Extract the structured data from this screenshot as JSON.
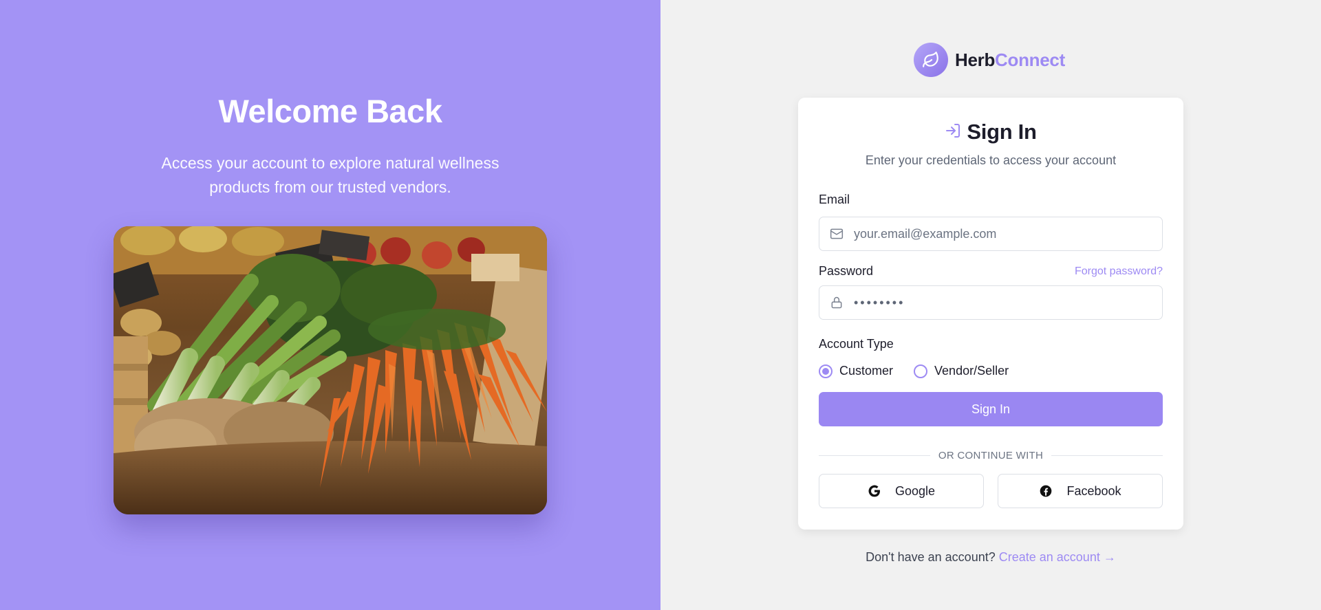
{
  "hero": {
    "title": "Welcome Back",
    "subtitle": "Access your account to explore natural wellness products from our trusted vendors."
  },
  "brand": {
    "name_part1": "Herb",
    "name_part2": "Connect",
    "logo_icon": "leaf-icon",
    "accent_color": "#9d8af3"
  },
  "signin": {
    "title": "Sign In",
    "title_icon": "login-icon",
    "subtitle": "Enter your credentials to access your account",
    "email_label": "Email",
    "email_placeholder": "your.email@example.com",
    "email_icon": "mail-icon",
    "password_label": "Password",
    "password_value": "••••••••",
    "password_icon": "lock-icon",
    "forgot_label": "Forgot password?",
    "account_type_label": "Account Type",
    "account_types": [
      {
        "label": "Customer",
        "selected": true
      },
      {
        "label": "Vendor/Seller",
        "selected": false
      }
    ],
    "submit_label": "Sign In",
    "divider_text": "OR CONTINUE WITH",
    "social": [
      {
        "label": "Google",
        "icon": "google-icon"
      },
      {
        "label": "Facebook",
        "icon": "facebook-icon"
      }
    ]
  },
  "footer": {
    "prompt": "Don't have an account?",
    "link_label": "Create an account →"
  }
}
